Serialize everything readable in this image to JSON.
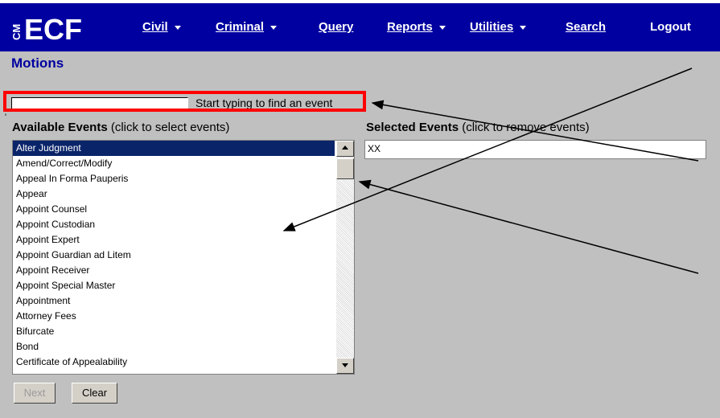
{
  "app": {
    "logo_prefix": "CM",
    "logo": "ECF"
  },
  "menu": {
    "civil": "Civil",
    "criminal": "Criminal",
    "query": "Query",
    "reports": "Reports",
    "utilities": "Utilities",
    "search": "Search",
    "logout": "Logout"
  },
  "page": {
    "title": "Motions"
  },
  "search": {
    "value": "",
    "hint": "Start typing to find an event"
  },
  "available": {
    "label_bold": "Available Events",
    "label_rest": " (click to select events)",
    "items": [
      "Alter Judgment",
      "Amend/Correct/Modify",
      "Appeal In Forma Pauperis",
      "Appear",
      "Appoint Counsel",
      "Appoint Custodian",
      "Appoint Expert",
      "Appoint Guardian ad Litem",
      "Appoint Receiver",
      "Appoint Special Master",
      "Appointment",
      "Attorney Fees",
      "Bifurcate",
      "Bond",
      "Certificate of Appealability"
    ],
    "selected_index": 0
  },
  "selected": {
    "label_bold": "Selected Events",
    "label_rest": " (click to remove events)",
    "items": [
      "XX"
    ]
  },
  "buttons": {
    "next": "Next",
    "clear": "Clear"
  },
  "colors": {
    "navbar": "#0000a0",
    "highlight": "#0a246a",
    "annotation": "#ff0000"
  }
}
